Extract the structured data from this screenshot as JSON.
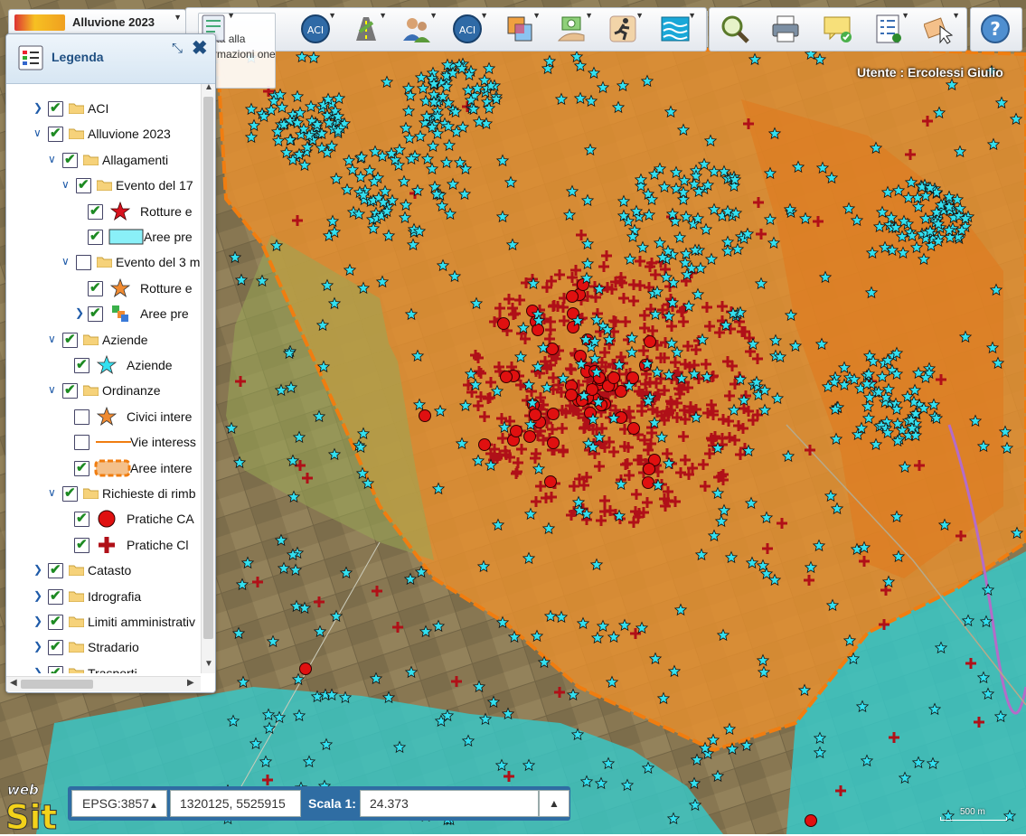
{
  "toolbar": {
    "project_name": "Alluvione 2023",
    "info_text": "nata alla formazioni one",
    "buttons": [
      {
        "name": "aci-layer-button",
        "icon": "aci-icon"
      },
      {
        "name": "roads-button",
        "icon": "road-icon"
      },
      {
        "name": "users-button",
        "icon": "users-icon"
      },
      {
        "name": "aci-tool-button",
        "icon": "aci-icon"
      },
      {
        "name": "layers-button",
        "icon": "layers-icon"
      },
      {
        "name": "payments-button",
        "icon": "money-icon"
      },
      {
        "name": "events-button",
        "icon": "runner-icon"
      },
      {
        "name": "hydrography-button",
        "icon": "water-icon"
      },
      {
        "name": "search-button",
        "icon": "magnifier-icon"
      },
      {
        "name": "print-button",
        "icon": "printer-icon"
      },
      {
        "name": "notes-button",
        "icon": "comment-icon"
      },
      {
        "name": "list-button",
        "icon": "checklist-icon"
      },
      {
        "name": "select-button",
        "icon": "cursor-icon"
      },
      {
        "name": "help-button",
        "icon": "help-icon"
      }
    ]
  },
  "legend": {
    "title": "Legenda",
    "items": [
      {
        "label": "ACI",
        "level": 0,
        "expander": "closed",
        "checked": true,
        "type": "folder"
      },
      {
        "label": "Alluvione 2023",
        "level": 0,
        "expander": "open",
        "checked": true,
        "type": "folder"
      },
      {
        "label": "Allagamenti",
        "level": 1,
        "expander": "open",
        "checked": true,
        "type": "folder"
      },
      {
        "label": "Evento del 17",
        "level": 2,
        "expander": "open",
        "checked": true,
        "type": "folder"
      },
      {
        "label": "Rotture e",
        "level": 3,
        "expander": "none",
        "checked": true,
        "type": "symbol",
        "symbol": "star-red"
      },
      {
        "label": "Aree pre",
        "level": 3,
        "expander": "none",
        "checked": true,
        "type": "symbol",
        "symbol": "box-cyan"
      },
      {
        "label": "Evento del 3 m",
        "level": 2,
        "expander": "open",
        "checked": false,
        "type": "folder"
      },
      {
        "label": "Rotture e",
        "level": 3,
        "expander": "none",
        "checked": true,
        "type": "symbol",
        "symbol": "star-orange"
      },
      {
        "label": "Aree pre",
        "level": 3,
        "expander": "closed",
        "checked": true,
        "type": "symbol",
        "symbol": "multi"
      },
      {
        "label": "Aziende",
        "level": 1,
        "expander": "open",
        "checked": true,
        "type": "folder"
      },
      {
        "label": "Aziende",
        "level": 2,
        "expander": "none",
        "checked": true,
        "type": "symbol",
        "symbol": "star-cyan"
      },
      {
        "label": "Ordinanze",
        "level": 1,
        "expander": "open",
        "checked": true,
        "type": "folder"
      },
      {
        "label": "Civici intere",
        "level": 2,
        "expander": "none",
        "checked": false,
        "type": "symbol",
        "symbol": "star-orange"
      },
      {
        "label": "Vie interess",
        "level": 2,
        "expander": "none",
        "checked": false,
        "type": "symbol",
        "symbol": "line-orange"
      },
      {
        "label": "Aree intere",
        "level": 2,
        "expander": "none",
        "checked": true,
        "type": "symbol",
        "symbol": "dashed-orange"
      },
      {
        "label": "Richieste di rimb",
        "level": 1,
        "expander": "open",
        "checked": true,
        "type": "folder"
      },
      {
        "label": "Pratiche CA",
        "level": 2,
        "expander": "none",
        "checked": true,
        "type": "symbol",
        "symbol": "circle-red"
      },
      {
        "label": "Pratiche Cl",
        "level": 2,
        "expander": "none",
        "checked": true,
        "type": "symbol",
        "symbol": "cross-red"
      },
      {
        "label": "Catasto",
        "level": 0,
        "expander": "closed",
        "checked": true,
        "type": "folder"
      },
      {
        "label": "Idrografia",
        "level": 0,
        "expander": "closed",
        "checked": true,
        "type": "folder"
      },
      {
        "label": "Limiti amministrativ",
        "level": 0,
        "expander": "closed",
        "checked": true,
        "type": "folder"
      },
      {
        "label": "Stradario",
        "level": 0,
        "expander": "closed",
        "checked": true,
        "type": "folder"
      },
      {
        "label": "Trasporti",
        "level": 0,
        "expander": "closed",
        "checked": true,
        "type": "folder"
      }
    ]
  },
  "user": {
    "label": "Utente : Ercolessi Giulio"
  },
  "status": {
    "projection": "EPSG:3857",
    "coordinates": "1320125, 5525915",
    "scale_label": "Scala 1:",
    "scale_value": "24.373"
  },
  "scalebar": {
    "label": "500 m"
  },
  "logo": {
    "line1": "web",
    "line2": "Sit"
  },
  "colors": {
    "accent": "#2f6da3",
    "legend_title": "#1f4f82",
    "flood_orange": "#e8902e",
    "flood_cyan": "#37c8c8",
    "marker_red": "#d9121e",
    "marker_star": "#33e0f0"
  }
}
